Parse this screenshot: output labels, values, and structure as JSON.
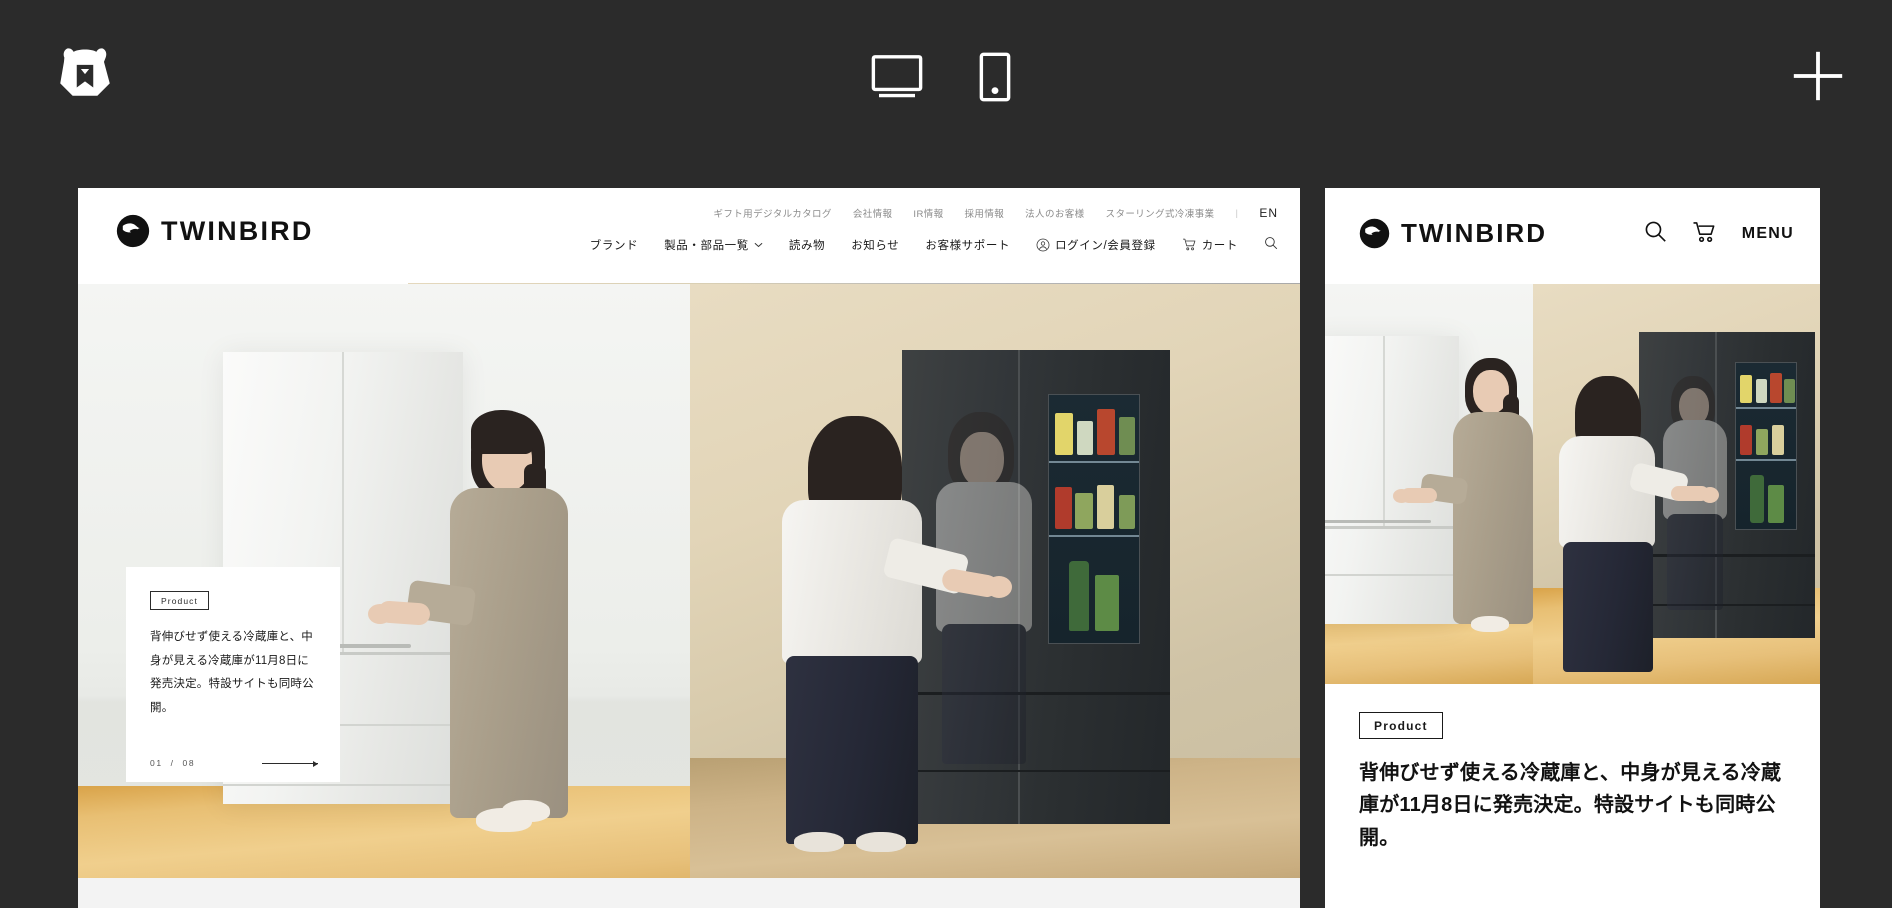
{
  "app": {
    "logo_icon": "bear-bookmark-logo",
    "viewport_desktop_icon": "desktop-monitor-icon",
    "viewport_mobile_icon": "mobile-phone-icon",
    "add_icon": "plus-icon",
    "background_color": "#2b2b2b"
  },
  "site": {
    "brand": {
      "name": "TWINBIRD",
      "logo_icon": "twinbird-circle-logo"
    },
    "utility_nav": [
      {
        "label": "ギフト用デジタルカタログ"
      },
      {
        "label": "会社情報"
      },
      {
        "label": "IR情報"
      },
      {
        "label": "採用情報"
      },
      {
        "label": "法人のお客様"
      },
      {
        "label": "スターリング式冷凍事業"
      }
    ],
    "utility_separator": "|",
    "language_toggle": "EN",
    "main_nav": [
      {
        "label": "ブランド",
        "icon": null
      },
      {
        "label": "製品・部品一覧",
        "icon": "chevron-down-icon"
      },
      {
        "label": "読み物",
        "icon": null
      },
      {
        "label": "お知らせ",
        "icon": null
      },
      {
        "label": "お客様サポート",
        "icon": null
      }
    ],
    "account": {
      "label": "ログイン/会員登録",
      "icon": "user-circle-icon"
    },
    "cart": {
      "label": "カート",
      "icon": "shopping-cart-icon"
    },
    "search": {
      "icon": "search-icon"
    }
  },
  "hero": {
    "badge": "Product",
    "headline": "背伸びせず使える冷蔵庫と、中身が見える冷蔵庫が11月8日に発売決定。特設サイトも同時公開。",
    "counter_current": "01",
    "counter_separator": "/",
    "counter_total": "08",
    "next_icon": "arrow-right-icon"
  },
  "mobile": {
    "search_icon": "search-icon",
    "cart_icon": "shopping-cart-icon",
    "menu_label": "MENU",
    "badge": "Product",
    "headline": "背伸びせず使える冷蔵庫と、中身が見える冷蔵庫が11月8日に発売決定。特設サイトも同時公開。"
  }
}
